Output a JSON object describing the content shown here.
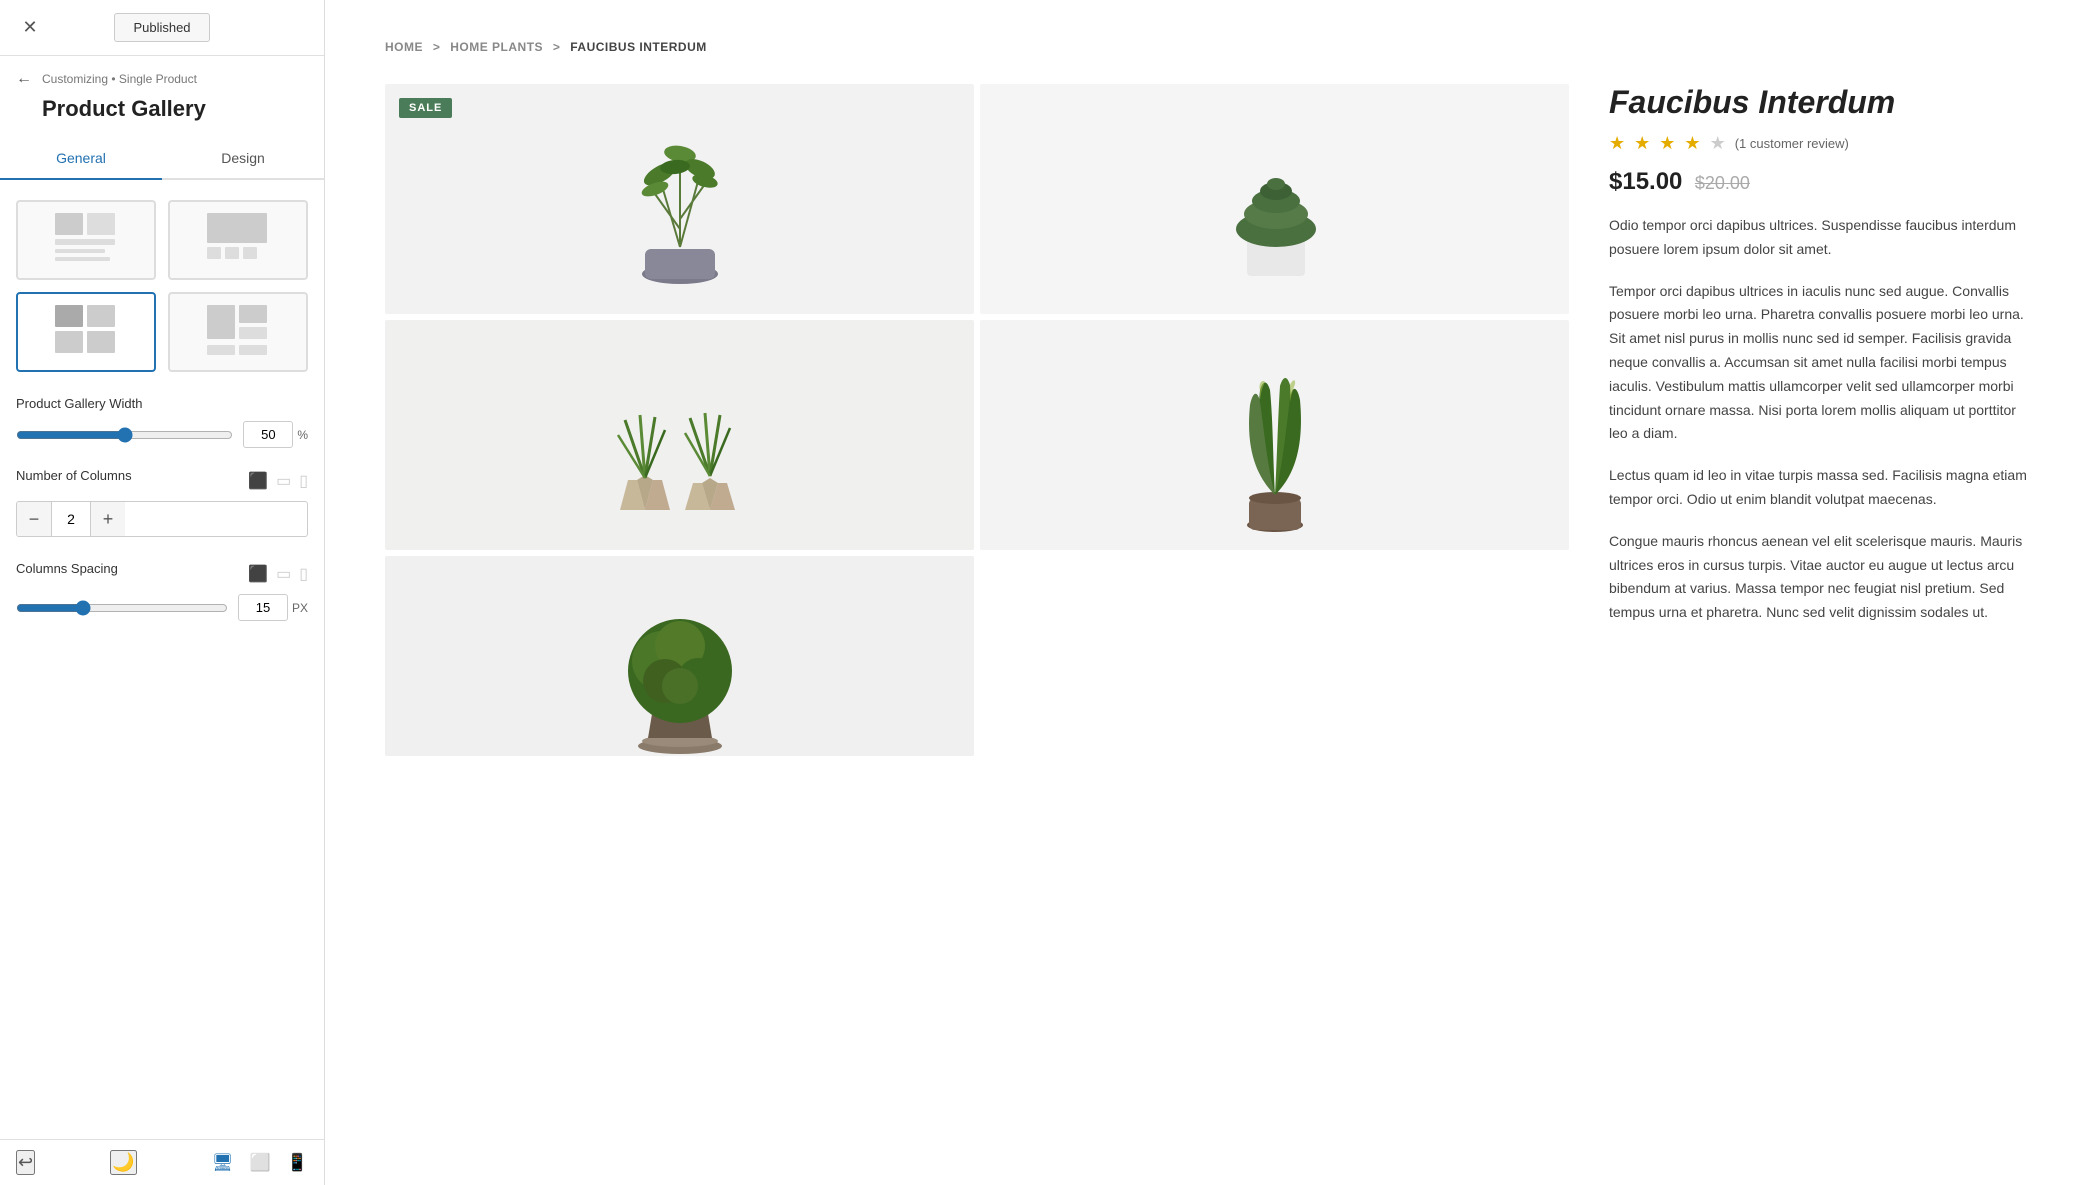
{
  "header": {
    "published_label": "Published",
    "close_icon": "✕"
  },
  "sidebar": {
    "breadcrumb": "Customizing • Single Product",
    "title": "Product Gallery",
    "tabs": [
      {
        "label": "General",
        "active": true
      },
      {
        "label": "Design",
        "active": false
      }
    ],
    "gallery_width": {
      "label": "Product Gallery Width",
      "value": "50",
      "unit": "%",
      "min": 0,
      "max": 100
    },
    "columns": {
      "label": "Number of Columns",
      "value": "2"
    },
    "columns_spacing": {
      "label": "Columns Spacing",
      "value": "15",
      "unit": "PX"
    }
  },
  "preview": {
    "breadcrumb": {
      "home": "HOME",
      "sep1": ">",
      "category": "HOME PLANTS",
      "sep2": ">",
      "current": "FAUCIBUS INTERDUM"
    },
    "product": {
      "title": "Faucibus Interdum",
      "stars": 3.5,
      "review_count": "(1 customer review)",
      "current_price": "$15.00",
      "original_price": "$20.00",
      "sale_badge": "SALE",
      "descriptions": [
        "Odio tempor orci dapibus ultrices. Suspendisse faucibus interdum posuere lorem ipsum dolor sit amet.",
        "Tempor orci dapibus ultrices in iaculis nunc sed augue. Convallis posuere morbi leo urna. Pharetra convallis posuere morbi leo urna. Sit amet nisl purus in mollis nunc sed id semper. Facilisis gravida neque convallis a. Accumsan sit amet nulla facilisi morbi tempus iaculis. Vestibulum mattis ullamcorper velit sed ullamcorper morbi tincidunt ornare massa. Nisi porta lorem mollis aliquam ut porttitor leo a diam.",
        "Lectus quam id leo in vitae turpis massa sed. Facilisis magna etiam tempor orci. Odio ut enim blandit volutpat maecenas.",
        "Congue mauris rhoncus aenean vel elit scelerisque mauris. Mauris ultrices eros in cursus turpis. Vitae auctor eu augue ut lectus arcu bibendum at varius. Massa tempor nec feugiat nisl pretium. Sed tempus urna et pharetra. Nunc sed velit dignissim sodales ut."
      ]
    }
  },
  "bottom_bar": {
    "back_icon": "↩",
    "moon_icon": "🌙",
    "desktop_icon": "🖥",
    "tablet_icon": "⬜",
    "mobile_icon": "📱"
  }
}
